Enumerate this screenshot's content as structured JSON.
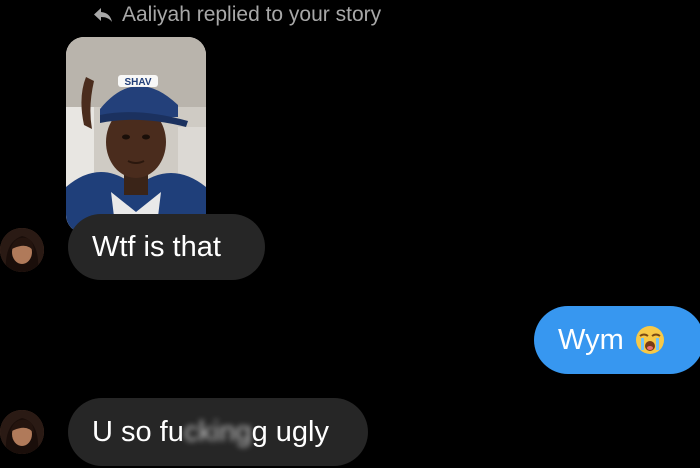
{
  "story_reply": {
    "header_text": "Aaliyah replied to your story",
    "thumbnail_icon": "story-photo-thumbnail",
    "cap_text": "SHAV"
  },
  "messages": [
    {
      "sender": "Aaliyah",
      "direction": "incoming",
      "text": "Wtf is that"
    },
    {
      "sender": "me",
      "direction": "outgoing",
      "text": "Wym",
      "emoji": "loudly-crying-face-icon"
    },
    {
      "sender": "Aaliyah",
      "direction": "incoming",
      "text_start": "U so fu",
      "text_hidden": "cking",
      "text_end": "g ugly"
    }
  ],
  "colors": {
    "background": "#000000",
    "incoming_bubble": "#262626",
    "outgoing_bubble": "#3797f0",
    "header_text": "#a8a8a8"
  }
}
